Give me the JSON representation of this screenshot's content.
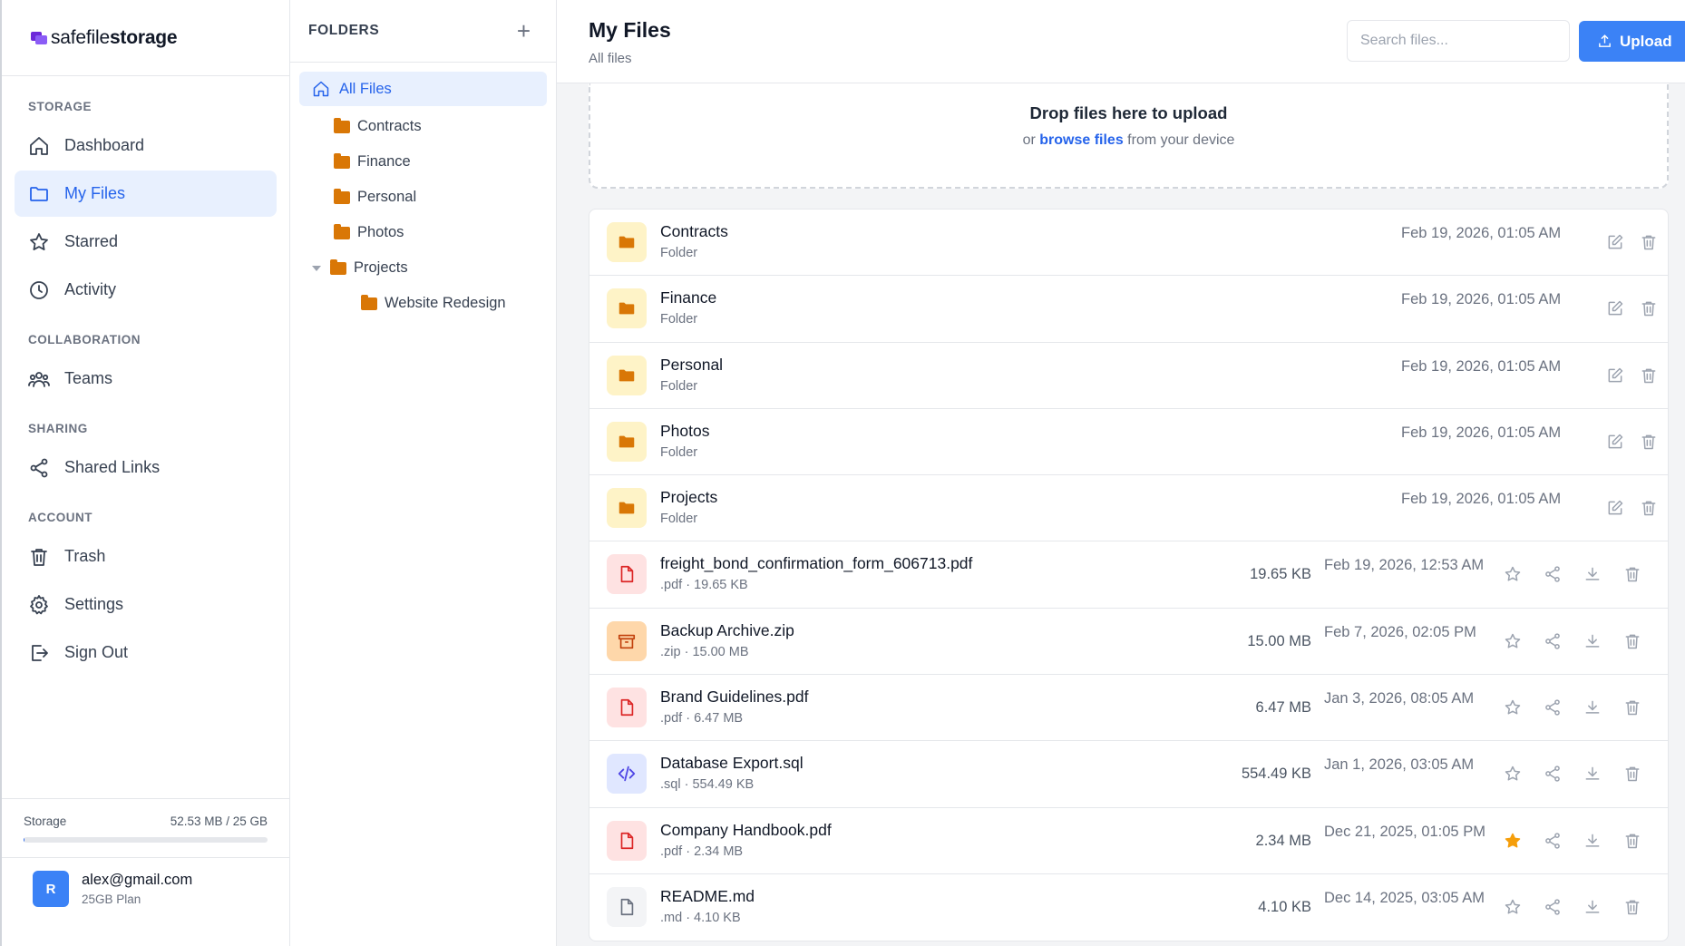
{
  "brand": {
    "name_light": "safefile",
    "name_bold": "storage"
  },
  "sidebar": {
    "sections": [
      {
        "heading": "STORAGE",
        "items": [
          {
            "label": "Dashboard",
            "icon": "home-icon"
          },
          {
            "label": "My Files",
            "icon": "folder-icon",
            "active": true
          },
          {
            "label": "Starred",
            "icon": "star-icon"
          },
          {
            "label": "Activity",
            "icon": "clock-icon"
          }
        ]
      },
      {
        "heading": "COLLABORATION",
        "items": [
          {
            "label": "Teams",
            "icon": "users-icon"
          }
        ]
      },
      {
        "heading": "SHARING",
        "items": [
          {
            "label": "Shared Links",
            "icon": "share-icon"
          }
        ]
      },
      {
        "heading": "ACCOUNT",
        "items": [
          {
            "label": "Trash",
            "icon": "trash-icon"
          },
          {
            "label": "Settings",
            "icon": "gear-icon"
          },
          {
            "label": "Sign Out",
            "icon": "sign-out-icon"
          }
        ]
      }
    ],
    "storage": {
      "label": "Storage",
      "usage": "52.53 MB / 25 GB",
      "used_fraction": 0.0021
    },
    "user": {
      "initial": "R",
      "email": "alex@gmail.com",
      "plan": "25GB Plan"
    }
  },
  "folders_panel": {
    "title": "FOLDERS",
    "add_label": "+",
    "all_files": "All Files",
    "tree": [
      {
        "label": "Contracts",
        "depth": 0
      },
      {
        "label": "Finance",
        "depth": 0
      },
      {
        "label": "Personal",
        "depth": 0
      },
      {
        "label": "Photos",
        "depth": 0
      },
      {
        "label": "Projects",
        "depth": 0,
        "expanded": true
      },
      {
        "label": "Website Redesign",
        "depth": 1
      }
    ]
  },
  "header": {
    "title": "My Files",
    "subtitle": "All files",
    "search_placeholder": "Search files...",
    "upload_label": "Upload"
  },
  "dropzone": {
    "title": "Drop files here to upload",
    "pre": "or ",
    "link": "browse files",
    "post": " from your device"
  },
  "files": [
    {
      "name": "Contracts",
      "meta": "Folder",
      "size": "",
      "date": "Feb 19, 2026, 01:05 AM",
      "kind": "folder"
    },
    {
      "name": "Finance",
      "meta": "Folder",
      "size": "",
      "date": "Feb 19, 2026, 01:05 AM",
      "kind": "folder"
    },
    {
      "name": "Personal",
      "meta": "Folder",
      "size": "",
      "date": "Feb 19, 2026, 01:05 AM",
      "kind": "folder"
    },
    {
      "name": "Photos",
      "meta": "Folder",
      "size": "",
      "date": "Feb 19, 2026, 01:05 AM",
      "kind": "folder"
    },
    {
      "name": "Projects",
      "meta": "Folder",
      "size": "",
      "date": "Feb 19, 2026, 01:05 AM",
      "kind": "folder"
    },
    {
      "name": "freight_bond_confirmation_form_606713.pdf",
      "meta": ".pdf · 19.65 KB",
      "size": "19.65 KB",
      "date": "Feb 19, 2026, 12:53 AM",
      "kind": "pdf",
      "starred": false
    },
    {
      "name": "Backup Archive.zip",
      "meta": ".zip · 15.00 MB",
      "size": "15.00 MB",
      "date": "Feb 7, 2026, 02:05 PM",
      "kind": "zip",
      "starred": false
    },
    {
      "name": "Brand Guidelines.pdf",
      "meta": ".pdf · 6.47 MB",
      "size": "6.47 MB",
      "date": "Jan 3, 2026, 08:05 AM",
      "kind": "pdf",
      "starred": false
    },
    {
      "name": "Database Export.sql",
      "meta": ".sql · 554.49 KB",
      "size": "554.49 KB",
      "date": "Jan 1, 2026, 03:05 AM",
      "kind": "code",
      "starred": false
    },
    {
      "name": "Company Handbook.pdf",
      "meta": ".pdf · 2.34 MB",
      "size": "2.34 MB",
      "date": "Dec 21, 2025, 01:05 PM",
      "kind": "pdf",
      "starred": true
    },
    {
      "name": "README.md",
      "meta": ".md · 4.10 KB",
      "size": "4.10 KB",
      "date": "Dec 14, 2025, 03:05 AM",
      "kind": "doc",
      "starred": false
    }
  ],
  "colors": {
    "accent": "#2563eb",
    "folder": "#d97706",
    "star": "#f59e0b",
    "pdf": "#dc2626"
  }
}
